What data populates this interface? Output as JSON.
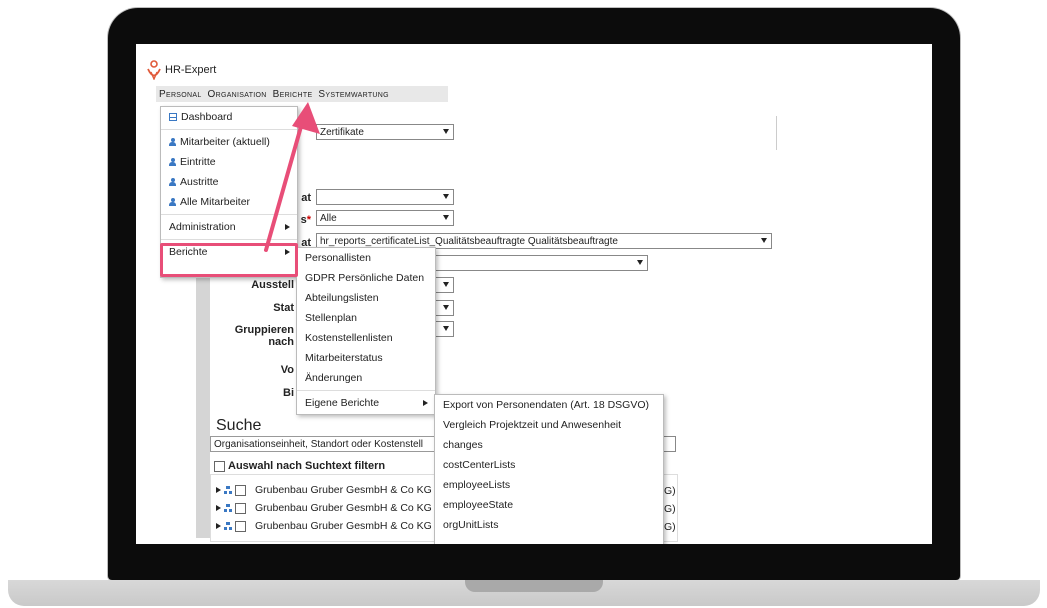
{
  "app": {
    "name": "HR-Expert"
  },
  "menubar": [
    "Personal",
    "Organisation",
    "Berichte",
    "Systemwartung"
  ],
  "form": {
    "field_zertifikate": "Zertifikate",
    "label_at1": "at",
    "label_req": "s",
    "req_mark": "*",
    "select_alle": "Alle",
    "label_at2": "at",
    "select_report": "hr_reports_certificateList_Qualitätsbeauftragte Qualitätsbeauftragte",
    "label_aussteller": "Ausstell",
    "label_status": "Stat",
    "label_gruppieren": "Gruppieren nach",
    "label_von": "Vo",
    "label_bis": "Bi"
  },
  "personal_menu": {
    "dashboard": "Dashboard",
    "items": [
      "Mitarbeiter (aktuell)",
      "Eintritte",
      "Austritte",
      "Alle Mitarbeiter"
    ],
    "administration": "Administration",
    "berichte": "Berichte"
  },
  "berichte_menu": [
    "Personallisten",
    "GDPR Persönliche Daten",
    "Abteilungslisten",
    "Stellenplan",
    "Kostenstellenlisten",
    "Mitarbeiterstatus",
    "Änderungen"
  ],
  "eigene_berichte_label": "Eigene Berichte",
  "eigene_menu": [
    "Export von Personendaten (Art. 18 DSGVO)",
    "Vergleich Projektzeit und Anwesenheit",
    "changes",
    "costCenterLists",
    "employeeLists",
    "employeeState",
    "orgUnitLists"
  ],
  "search": {
    "title": "Suche",
    "placeholder": "Organisationseinheit, Standort oder Kostenstell",
    "filter_label": "Auswahl nach Suchtext filtern"
  },
  "tree": [
    {
      "label": "Grubenbau Gruber GesmbH & Co KG L",
      "suffix": "G)"
    },
    {
      "label": "Grubenbau Gruber GesmbH & Co KG O",
      "suffix": "G)"
    },
    {
      "label": "Grubenbau Gruber GesmbH & Co KG K",
      "suffix": "G)"
    }
  ],
  "colors": {
    "highlight": "#e84e78",
    "icon_blue": "#3a78c3"
  }
}
